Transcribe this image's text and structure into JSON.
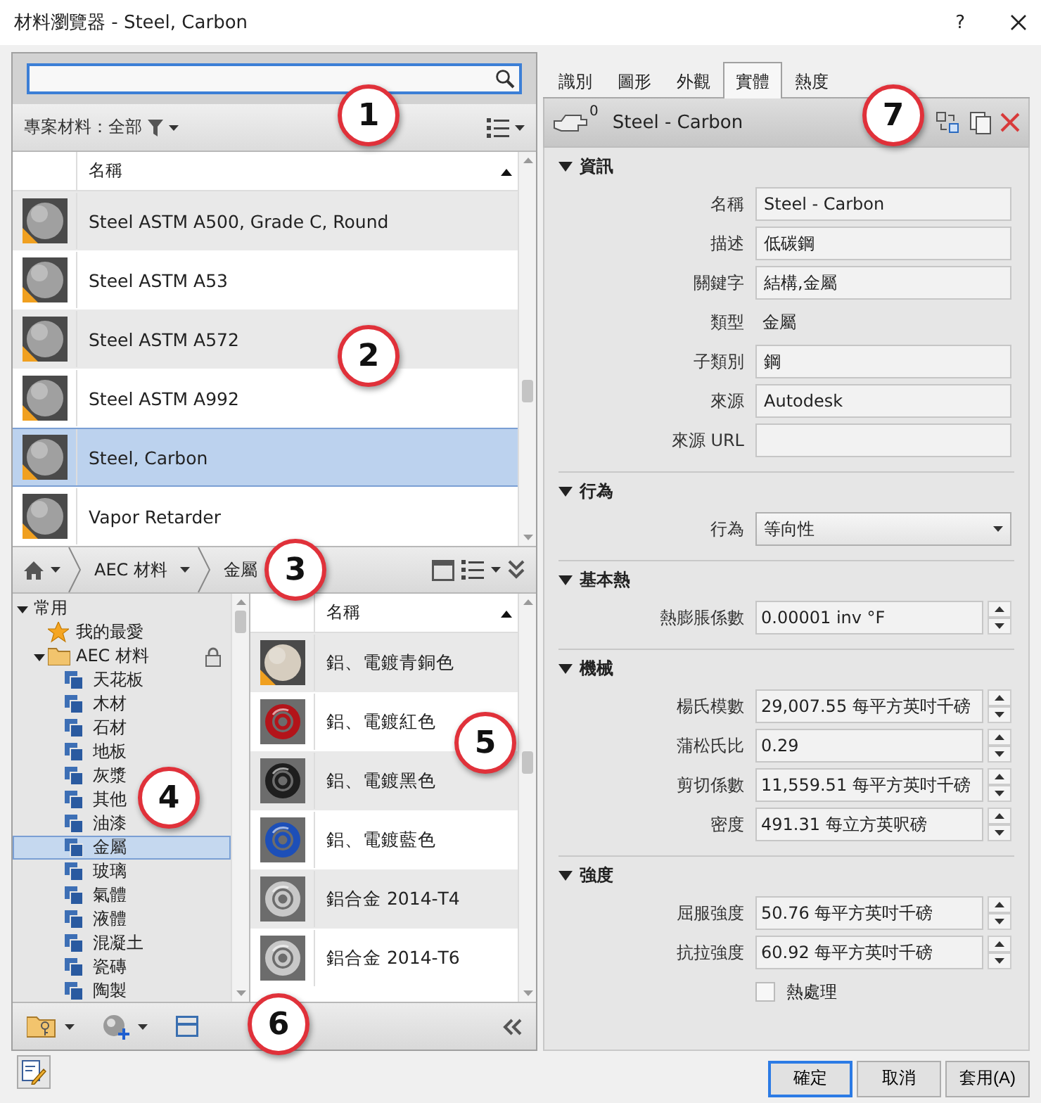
{
  "window": {
    "title": "材料瀏覽器 - Steel, Carbon",
    "help": "?"
  },
  "filter": {
    "label": "專案材料：全部"
  },
  "project_list": {
    "column": "名稱",
    "rows": [
      {
        "name": "Steel ASTM A500, Grade C, Round",
        "warning": true,
        "selected": false
      },
      {
        "name": "Steel ASTM A53",
        "warning": true,
        "selected": false
      },
      {
        "name": "Steel ASTM A572",
        "warning": true,
        "selected": false
      },
      {
        "name": "Steel ASTM A992",
        "warning": true,
        "selected": false
      },
      {
        "name": "Steel, Carbon",
        "warning": true,
        "selected": true
      },
      {
        "name": "Vapor Retarder",
        "warning": true,
        "selected": false
      }
    ]
  },
  "breadcrumb": [
    "AEC 材料",
    "金屬"
  ],
  "tree": [
    {
      "label": "常用",
      "expanded": true,
      "selected": false,
      "children": [
        {
          "label": "我的最愛",
          "kind": "favorite",
          "selected": false
        },
        {
          "label": "AEC 材料",
          "kind": "library",
          "expanded": true,
          "locked": true,
          "selected": false,
          "children": [
            {
              "label": "天花板",
              "kind": "category",
              "selected": false
            },
            {
              "label": "木材",
              "kind": "category",
              "selected": false
            },
            {
              "label": "石材",
              "kind": "category",
              "selected": false
            },
            {
              "label": "地板",
              "kind": "category",
              "selected": false
            },
            {
              "label": "灰漿",
              "kind": "category",
              "selected": false
            },
            {
              "label": "其他",
              "kind": "category",
              "selected": false
            },
            {
              "label": "油漆",
              "kind": "category",
              "selected": false
            },
            {
              "label": "金屬",
              "kind": "category",
              "selected": true
            },
            {
              "label": "玻璃",
              "kind": "category",
              "selected": false
            },
            {
              "label": "氣體",
              "kind": "category",
              "selected": false
            },
            {
              "label": "液體",
              "kind": "category",
              "selected": false
            },
            {
              "label": "混凝土",
              "kind": "category",
              "selected": false
            },
            {
              "label": "瓷磚",
              "kind": "category",
              "selected": false
            },
            {
              "label": "陶製",
              "kind": "category",
              "selected": false
            }
          ]
        }
      ]
    }
  ],
  "library_list": {
    "column": "名稱",
    "rows": [
      {
        "name": "鋁、電鍍青銅色",
        "kind": "sphere",
        "color": "#d6cdbf",
        "warning": true
      },
      {
        "name": "鋁、電鍍紅色",
        "kind": "ring",
        "color": "#b3141a",
        "warning": false
      },
      {
        "name": "鋁、電鍍黑色",
        "kind": "ring",
        "color": "#1e1e1e",
        "warning": false
      },
      {
        "name": "鋁、電鍍藍色",
        "kind": "ring",
        "color": "#1d4fb8",
        "warning": false
      },
      {
        "name": "鋁合金 2014-T4",
        "kind": "ring",
        "color": "#c8c8c8",
        "warning": false
      },
      {
        "name": "鋁合金 2014-T6",
        "kind": "ring",
        "color": "#c8c8c8",
        "warning": false
      }
    ]
  },
  "tabs": [
    {
      "label": "識別",
      "selected": false
    },
    {
      "label": "圖形",
      "selected": false
    },
    {
      "label": "外觀",
      "selected": false
    },
    {
      "label": "實體",
      "selected": true
    },
    {
      "label": "熱度",
      "selected": false
    }
  ],
  "asset": {
    "count": "0",
    "name": "Steel - Carbon"
  },
  "sections": [
    {
      "title": "資訊",
      "expanded": true,
      "fields": [
        {
          "label": "名稱",
          "kind": "text",
          "value": "Steel - Carbon"
        },
        {
          "label": "描述",
          "kind": "text",
          "value": "低碳鋼"
        },
        {
          "label": "關鍵字",
          "kind": "text",
          "value": "結構,金屬"
        },
        {
          "label": "類型",
          "kind": "static",
          "value": "金屬"
        },
        {
          "label": "子類別",
          "kind": "text",
          "value": "鋼"
        },
        {
          "label": "來源",
          "kind": "text",
          "value": "Autodesk"
        },
        {
          "label": "來源 URL",
          "kind": "text"
        }
      ]
    },
    {
      "title": "行為",
      "expanded": true,
      "fields": [
        {
          "label": "行為",
          "kind": "dropdown",
          "value": "等向性"
        }
      ]
    },
    {
      "title": "基本熱",
      "expanded": true,
      "fields": [
        {
          "label": "熱膨脹係數",
          "kind": "spinner",
          "value": "0.00001 inv °F"
        }
      ]
    },
    {
      "title": "機械",
      "expanded": true,
      "fields": [
        {
          "label": "楊氏模數",
          "kind": "spinner",
          "value": "29,007.55 每平方英吋千磅"
        },
        {
          "label": "蒲松氏比",
          "kind": "spinner",
          "value": "0.29"
        },
        {
          "label": "剪切係數",
          "kind": "spinner",
          "value": "11,559.51 每平方英吋千磅"
        },
        {
          "label": "密度",
          "kind": "spinner",
          "value": "491.31 每立方英呎磅"
        }
      ]
    },
    {
      "title": "強度",
      "expanded": true,
      "fields": [
        {
          "label": "屈服強度",
          "kind": "spinner",
          "value": "50.76 每平方英吋千磅"
        },
        {
          "label": "抗拉強度",
          "kind": "spinner",
          "value": "60.92 每平方英吋千磅"
        },
        {
          "label": "熱處理",
          "kind": "checkbox",
          "checked": false
        }
      ]
    }
  ],
  "buttons": [
    {
      "label": "確定",
      "default": true
    },
    {
      "label": "取消",
      "default": false
    },
    {
      "label": "套用(A)",
      "default": false
    }
  ],
  "callouts": [
    "1",
    "2",
    "3",
    "4",
    "5",
    "6",
    "7"
  ]
}
